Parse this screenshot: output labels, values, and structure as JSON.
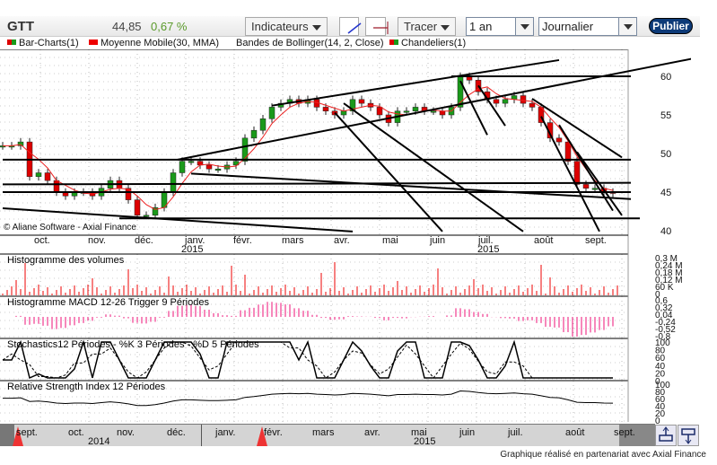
{
  "toolbar": {
    "symbol": "GTT",
    "price": "44,85",
    "change_pct": "0,67 %",
    "indicators_label": "Indicateurs",
    "draw_label": "Tracer",
    "period_value": "1 an",
    "interval_value": "Journalier",
    "publish_label": "Publier"
  },
  "legend": {
    "bar_charts": "Bar-Charts(1)",
    "moving_average": "Moyenne Mobile(30, MMA)",
    "bollinger": "Bandes de Bollinger(14, 2, Close)",
    "candlesticks": "Chandeliers(1)"
  },
  "copyright": "© Aliane Software - Axial Finance",
  "panels": {
    "volume": "Histogramme des volumes",
    "macd": "Histogramme MACD 12-26   Trigger 9 Périodes",
    "stoch": "Stochastics12 Périodes  -  %K 3 Périodes  -  %D 5 Périodes",
    "rsi": "Relative Strength Index 12 Périodes"
  },
  "axes": {
    "price_ticks": [
      "60",
      "55",
      "50",
      "45",
      "40"
    ],
    "volume_ticks": [
      "0,3 M",
      "0,24 M",
      "0,18 M",
      "0,12 M",
      "60 K",
      "0"
    ],
    "macd_ticks": [
      "0,6",
      "0,32",
      "0,04",
      "-0,24",
      "-0,52",
      "-0,8"
    ],
    "stoch_ticks": [
      "100",
      "80",
      "60",
      "40",
      "20",
      "0"
    ],
    "rsi_ticks": [
      "100",
      "80",
      "60",
      "40",
      "20",
      "0"
    ],
    "months": [
      "oct.",
      "nov.",
      "déc.",
      "janv.",
      "févr.",
      "mars",
      "avr.",
      "mai",
      "juin",
      "juil.",
      "août",
      "sept."
    ],
    "years": [
      "2015",
      "2015"
    ]
  },
  "nav": {
    "months": [
      "sept.",
      "oct.",
      "nov.",
      "déc.",
      "janv.",
      "févr.",
      "mars",
      "avr.",
      "mai",
      "juin",
      "juil.",
      "août",
      "sept."
    ],
    "years": [
      "2014",
      "2015"
    ]
  },
  "footer": "Graphique réalisé en partenariat avec Axial Finance",
  "colors": {
    "up": "#1a9a1a",
    "down": "#dd0000",
    "ma": "#ee2222",
    "volume": "#ee0000",
    "macd": "#ee1177"
  },
  "chart_data": {
    "type": "candlestick",
    "title": "GTT",
    "ylim": [
      40,
      62
    ],
    "closes": [
      51,
      51,
      51.5,
      47,
      47.5,
      46.5,
      45,
      44.5,
      45,
      45,
      44.5,
      45.5,
      46.5,
      45.5,
      44,
      42,
      42,
      43,
      45,
      47.5,
      49,
      49,
      48.5,
      48,
      48,
      48.5,
      49,
      52,
      53,
      54.5,
      56,
      56.5,
      57,
      56.5,
      57,
      56,
      55.5,
      55,
      55.5,
      57,
      56.5,
      56,
      55,
      54,
      55.5,
      55.5,
      56,
      55.5,
      55.5,
      55,
      56,
      60,
      59.5,
      58,
      57,
      56.5,
      57,
      57.5,
      56.5,
      56,
      54,
      52,
      51.5,
      49,
      46,
      45.5,
      45.5,
      45,
      44.85
    ],
    "moving_average_period": 30,
    "trendlines": [
      {
        "from": [
          19.5,
          49.2
        ],
        "to": [
          83.5,
          63.8
        ]
      },
      {
        "from": [
          30,
          56.2
        ],
        "to": [
          62,
          62.1
        ]
      },
      {
        "from": [
          0,
          49.2
        ],
        "to": [
          70,
          49.2
        ]
      },
      {
        "from": [
          0,
          46.0
        ],
        "to": [
          70,
          46.2
        ]
      },
      {
        "from": [
          0,
          45.0
        ],
        "to": [
          70,
          45.0
        ]
      },
      {
        "from": [
          13,
          41.6
        ],
        "to": [
          71,
          41.6
        ]
      },
      {
        "from": [
          0,
          42.9
        ],
        "to": [
          39,
          39.9
        ]
      },
      {
        "from": [
          21,
          47.4
        ],
        "to": [
          70,
          44.1
        ]
      },
      {
        "from": [
          37,
          55.3
        ],
        "to": [
          49,
          39.9
        ]
      },
      {
        "from": [
          38,
          56.5
        ],
        "to": [
          58,
          39.9
        ]
      },
      {
        "from": [
          50,
          60
        ],
        "to": [
          70,
          60
        ]
      },
      {
        "from": [
          51,
          59.4
        ],
        "to": [
          54,
          52.4
        ]
      },
      {
        "from": [
          53,
          58.8
        ],
        "to": [
          56,
          53.6
        ]
      },
      {
        "from": [
          59,
          57.1
        ],
        "to": [
          69,
          49.5
        ]
      },
      {
        "from": [
          60,
          54.8
        ],
        "to": [
          66.5,
          39.9
        ]
      },
      {
        "from": [
          62,
          53.7
        ],
        "to": [
          68,
          42.6
        ]
      },
      {
        "from": [
          64,
          50.2
        ],
        "to": [
          69,
          42.0
        ]
      }
    ]
  }
}
